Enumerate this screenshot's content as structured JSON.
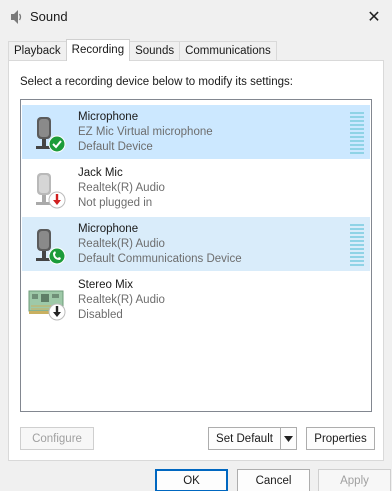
{
  "window": {
    "title": "Sound",
    "close_label": "✕"
  },
  "tabs": [
    {
      "label": "Playback",
      "active": false
    },
    {
      "label": "Recording",
      "active": true
    },
    {
      "label": "Sounds",
      "active": false
    },
    {
      "label": "Communications",
      "active": false
    }
  ],
  "panel": {
    "instruction": "Select a recording device below to modify its settings:"
  },
  "devices": [
    {
      "name": "Microphone",
      "line1": "EZ Mic Virtual microphone",
      "line2": "Default Device",
      "icon": "microphone-icon",
      "badge": "check-badge",
      "badge_color": "#1c9c3a",
      "state": "selected"
    },
    {
      "name": "Jack Mic",
      "line1": "Realtek(R) Audio",
      "line2": "Not plugged in",
      "icon": "microphone-icon",
      "badge": "down-arrow-badge",
      "badge_color": "#d02020",
      "state": "normal"
    },
    {
      "name": "Microphone",
      "line1": "Realtek(R) Audio",
      "line2": "Default Communications Device",
      "icon": "microphone-icon",
      "badge": "phone-badge",
      "badge_color": "#1c9c3a",
      "state": "highlighted"
    },
    {
      "name": "Stereo Mix",
      "line1": "Realtek(R) Audio",
      "line2": "Disabled",
      "icon": "circuit-board-icon",
      "badge": "down-arrow-badge",
      "badge_color": "#222222",
      "state": "normal"
    }
  ],
  "buttons": {
    "configure": "Configure",
    "set_default": "Set Default",
    "properties": "Properties",
    "ok": "OK",
    "cancel": "Cancel",
    "apply": "Apply"
  },
  "colors": {
    "selected_row": "#cce8ff",
    "highlight_row": "#d9ecfa",
    "accent": "#0067c0",
    "meter": "#8fd3e6"
  }
}
